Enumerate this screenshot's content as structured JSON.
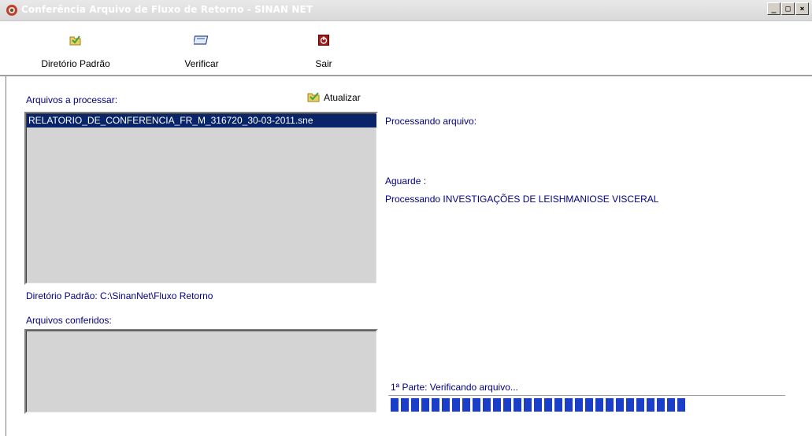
{
  "window": {
    "title": "Conferência Arquivo de Fluxo de Retorno - SINAN NET",
    "controls": {
      "minimize": "_",
      "maximize": "□",
      "close": "×"
    }
  },
  "toolbar": {
    "default_dir_label": "Diretório Padrão",
    "verify_label": "Verificar",
    "exit_label": "Sair"
  },
  "files_to_process": {
    "label": "Arquivos a processar:",
    "refresh_label": "Atualizar",
    "items": [
      "RELATORIO_DE_CONFERENCIA_FR_M_316720_30-03-2011.sne"
    ]
  },
  "default_dir": {
    "text": "Diretório Padrão: C:\\SinanNet\\Fluxo Retorno"
  },
  "checked_files": {
    "label": "Arquivos conferidos:",
    "items": []
  },
  "status": {
    "processing_label": "Processando arquivo:",
    "wait_label": "Aguarde :",
    "message": "Processando INVESTIGAÇÕES DE LEISHMANIOSE VISCERAL"
  },
  "progress": {
    "label": "1ª Parte: Verificando arquivo...",
    "filled_blocks": 29
  },
  "colors": {
    "label_blue": "#000080",
    "selection": "#0a246a",
    "progress": "#1a3ec8",
    "list_bg": "#d4d4d4"
  },
  "icons": [
    "app-icon",
    "folder-open-icon",
    "verify-icon",
    "exit-icon",
    "refresh-folder-icon"
  ]
}
